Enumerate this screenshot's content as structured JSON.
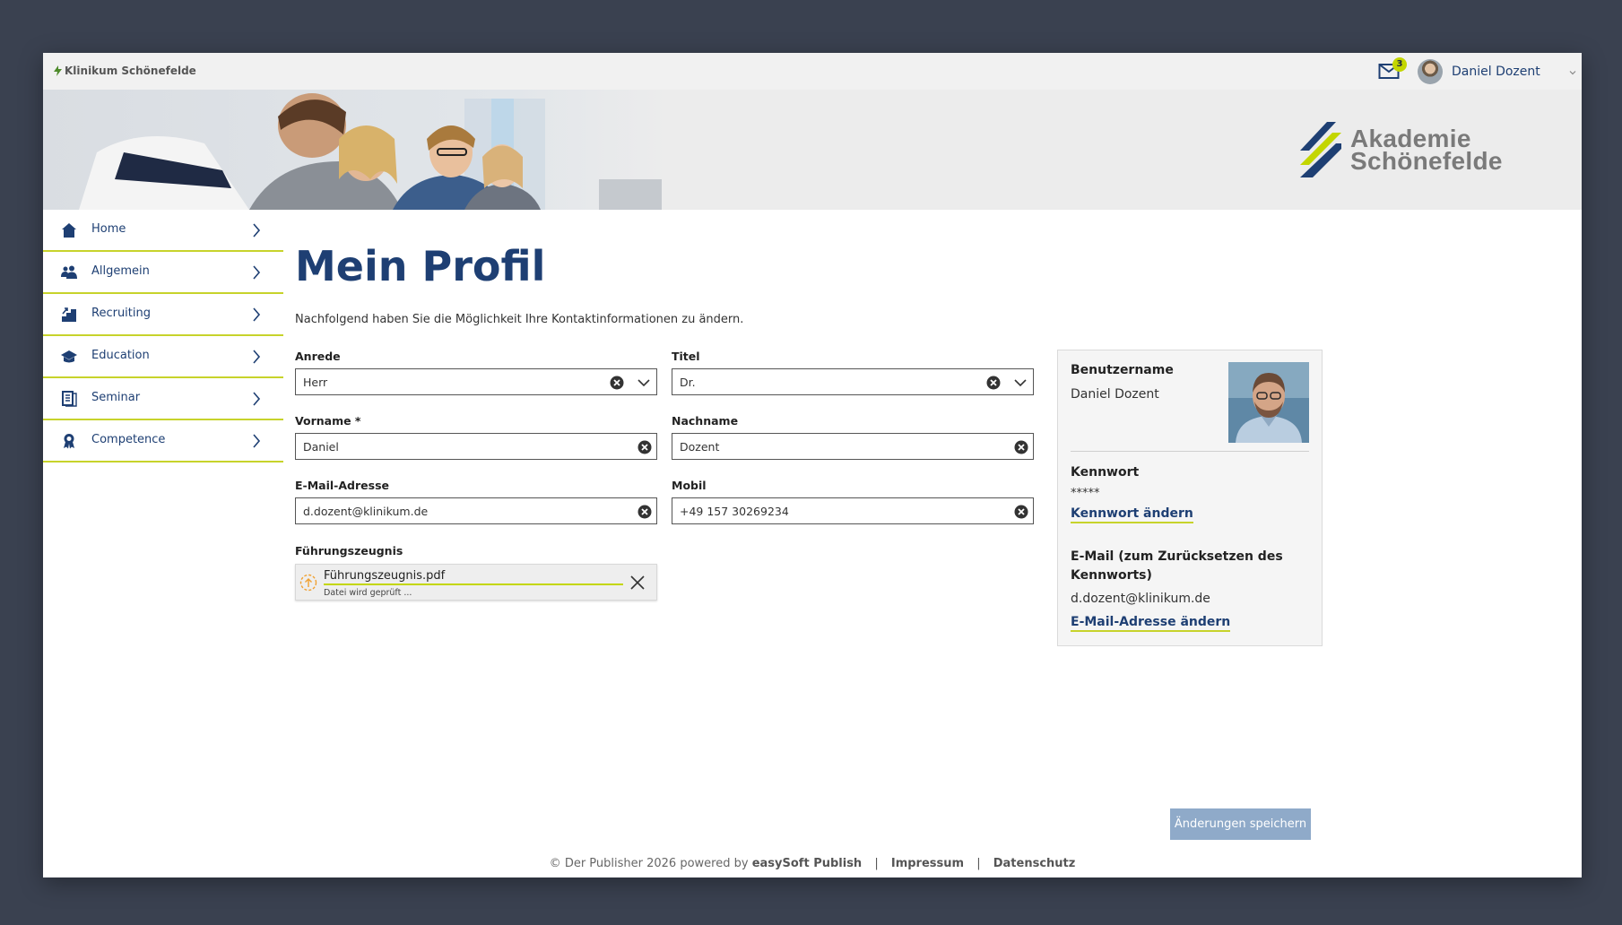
{
  "topbar": {
    "brand": "Klinikum Schönefelde",
    "mail_count": "3",
    "user_name": "Daniel Dozent"
  },
  "banner": {
    "logo_line1": "Akademie",
    "logo_line2": "Schönefelde"
  },
  "sidebar": {
    "items": [
      {
        "label": "Home",
        "icon": "home-icon"
      },
      {
        "label": "Allgemein",
        "icon": "users-icon"
      },
      {
        "label": "Recruiting",
        "icon": "recruiting-icon"
      },
      {
        "label": "Education",
        "icon": "graduation-cap-icon"
      },
      {
        "label": "Seminar",
        "icon": "document-icon"
      },
      {
        "label": "Competence",
        "icon": "award-icon"
      }
    ]
  },
  "main": {
    "title": "Mein Profil",
    "intro": "Nachfolgend haben Sie die Möglichkeit Ihre Kontaktinformationen zu ändern."
  },
  "form": {
    "anrede": {
      "label": "Anrede",
      "value": "Herr"
    },
    "titel": {
      "label": "Titel",
      "value": "Dr."
    },
    "vorname": {
      "label": "Vorname *",
      "value": "Daniel"
    },
    "nachname": {
      "label": "Nachname",
      "value": "Dozent"
    },
    "email": {
      "label": "E-Mail-Adresse",
      "value": "d.dozent@klinikum.de"
    },
    "mobil": {
      "label": "Mobil",
      "value": "+49 157 30269234"
    },
    "fuehrungszeugnis": {
      "label": "Führungszeugnis",
      "file_name": "Führungszeugnis.pdf",
      "status": "Datei wird geprüft ..."
    }
  },
  "card": {
    "username_label": "Benutzername",
    "username": "Daniel Dozent",
    "password_label": "Kennwort",
    "password_mask": "*****",
    "change_password": "Kennwort ändern",
    "email_label_line1": "E-Mail (zum Zurücksetzen des",
    "email_label_line2": "Kennworts)",
    "email": "d.dozent@klinikum.de",
    "change_email": "E-Mail-Adresse ändern"
  },
  "actions": {
    "save_label": "Änderungen speichern"
  },
  "footer": {
    "copyright": "Der Publisher 2026 powered by",
    "powered_by": "easySoft Publish",
    "impressum": "Impressum",
    "datenschutz": "Datenschutz"
  },
  "colors": {
    "primary": "#1e3f73",
    "accent": "#c3d600",
    "background": "#3a4150",
    "save_button": "#8faac9"
  }
}
